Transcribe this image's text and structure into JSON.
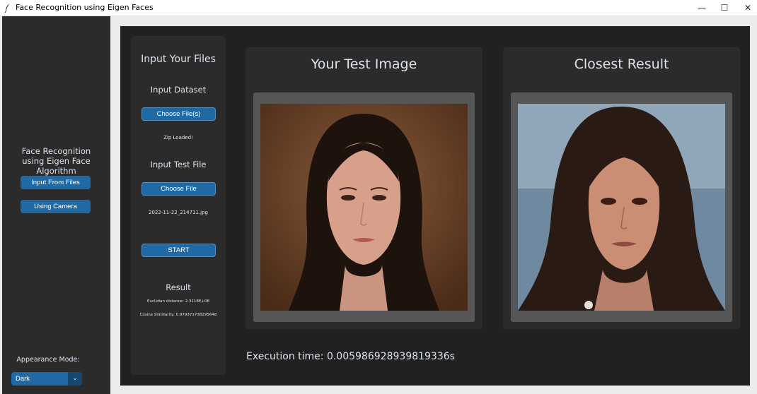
{
  "window": {
    "title": "Face Recognition using Eigen Faces",
    "controls": {
      "minimize": "—",
      "maximize": "☐",
      "close": "✕"
    }
  },
  "sidebar": {
    "heading_line1": "Face Recognition",
    "heading_line2": "using Eigen Face Algorithm",
    "input_files_button": "Input From Files",
    "camera_button": "Using Camera",
    "appearance_label": "Appearance Mode:",
    "appearance_value": "Dark"
  },
  "input_panel": {
    "title": "Input Your Files",
    "dataset_label": "Input Dataset",
    "dataset_button": "Choose File(s)",
    "dataset_status": "Zip Loaded!",
    "test_label": "Input Test File",
    "test_button": "Choose File",
    "test_filename": "2022-11-22_214711.jpg",
    "start_button": "START",
    "result_label": "Result",
    "euclidean": "Euclidian distance: 2.3118E+08",
    "cosine": "Cosine Similiarity: 0.979371738295648"
  },
  "test_card": {
    "title": "Your Test Image"
  },
  "result_card": {
    "title": "Closest Result"
  },
  "execution_time": "Execution time: 0.005986928939819336s",
  "colors": {
    "accent": "#1f6aa5",
    "panel": "#2b2b2b",
    "background": "#212121",
    "text": "#dce4ee"
  }
}
